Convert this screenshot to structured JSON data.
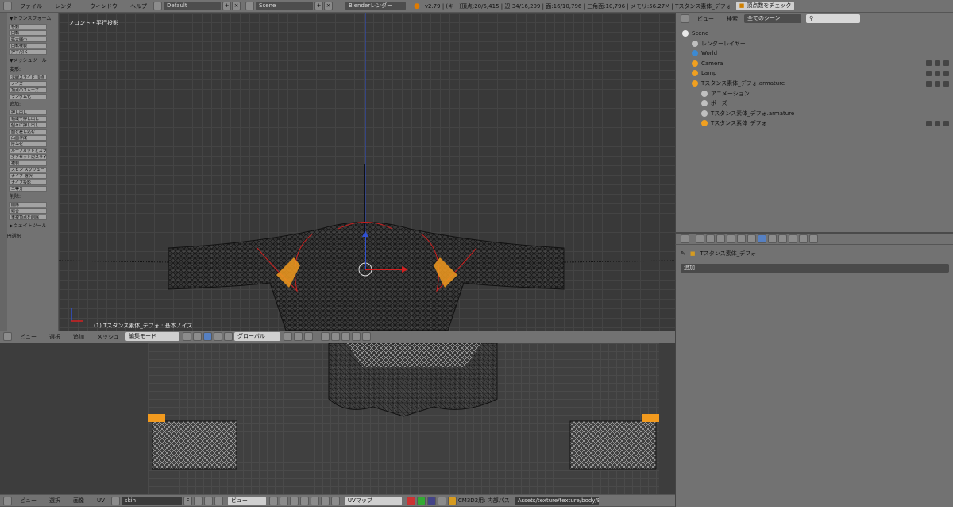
{
  "top_bar": {
    "menus": [
      "ファイル",
      "レンダー",
      "ウィンドウ",
      "ヘルプ"
    ],
    "layout": "Default",
    "scene": "Scene",
    "engine": "Blenderレンダー",
    "status": "v2.79 | (キー)頂点:20/5,415 | 辺:34/16,209 | 面:16/10,796 | 三角面:10,796 | メモリ:56.27M | Tスタンス素体_デフォ",
    "check_button": "頂点数をチェック"
  },
  "toolshelf": {
    "transform_title": "▼トランスフォーム",
    "transform_tools": [
      "移動",
      "回転",
      "拡大縮小",
      "回転複製",
      "押す/引く"
    ],
    "mesh_tools_title": "▼メッシュツール",
    "deform_label": "変形:",
    "deform_tools": [
      "法線スライド  頂点",
      "ノイズ",
      "頂点のスムーズ",
      "ランダム化"
    ],
    "add_label": "追加:",
    "add_tools": [
      "押し出し",
      "領域で押し出し",
      "個々に押し出し",
      "面を差し込む",
      "凸面作成",
      "厚み化",
      "ループカットとスライド",
      "オフセット辺スライド",
      "複製",
      "スピン  スクリュー",
      "ナイフ  選択",
      "ナイフ投影",
      "二等分"
    ],
    "remove_label": "削除:",
    "remove_tools": [
      "削除",
      "結合",
      "重複頂点を削除"
    ],
    "weight_title": "▶ウェイトツール",
    "mode_title": "▼円選択"
  },
  "viewport": {
    "view_label": "フロント・平行投影",
    "object_label": "(1) Tスタンス素体_デフォ : 基本ノイズ"
  },
  "view_header": {
    "menus": [
      "ビュー",
      "選択",
      "追加",
      "メッシュ"
    ],
    "mode": "編集モード",
    "orientation": "グローバル"
  },
  "uv_header": {
    "menus": [
      "ビュー",
      "選択",
      "画像",
      "UV"
    ],
    "image": "skin",
    "image_flag": "F",
    "view_mode": "ビュー",
    "uv_map": "UVマップ",
    "cm3d2_label": "CM3D2用: 内部パス",
    "path": "Assets/texture/texture/body/Body"
  },
  "outliner": {
    "header_menus": [
      "ビュー",
      "検索"
    ],
    "scene_filter": "全てのシーン",
    "tree": [
      {
        "label": "Scene",
        "indent": 0,
        "color": "#e9e9e9"
      },
      {
        "label": "レンダーレイヤー",
        "indent": 1,
        "color": "#c0c0c0"
      },
      {
        "label": "World",
        "indent": 1,
        "color": "#3c8ad4"
      },
      {
        "label": "Camera",
        "indent": 1,
        "color": "#f0a020"
      },
      {
        "label": "Lamp",
        "indent": 1,
        "color": "#f0a020"
      },
      {
        "label": "Tスタンス素体_デフォ.armature",
        "indent": 1,
        "color": "#f0a020"
      },
      {
        "label": "アニメーション",
        "indent": 2,
        "color": "#c0c0c0"
      },
      {
        "label": "ポーズ",
        "indent": 2,
        "color": "#c0c0c0"
      },
      {
        "label": "Tスタンス素体_デフォ.armature",
        "indent": 2,
        "color": "#c0c0c0"
      },
      {
        "label": "Tスタンス素体_デフォ",
        "indent": 2,
        "color": "#f0a020"
      }
    ]
  },
  "properties": {
    "object_name": "Tスタンス素体_デフォ",
    "add_dropdown": "追加"
  },
  "colors": {
    "panel": "#727272",
    "viewport_bg": "#393939",
    "selected_vertex": "#ff9a1a",
    "x_axis": "#d22020",
    "z_axis": "#3050d0"
  }
}
